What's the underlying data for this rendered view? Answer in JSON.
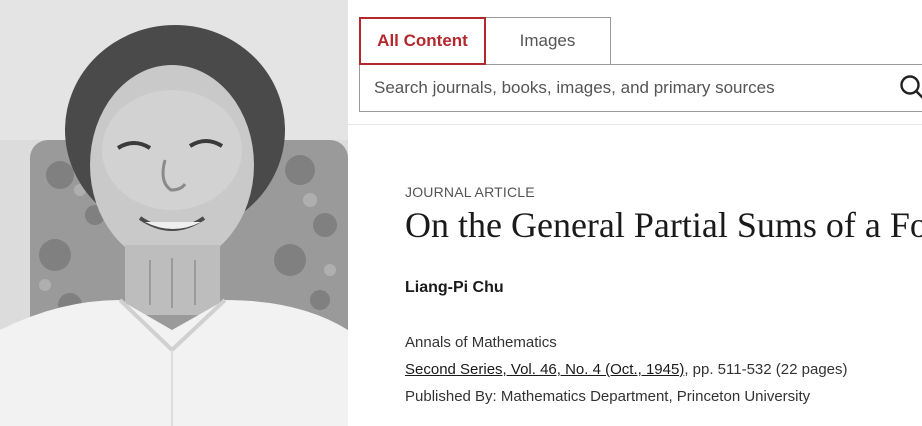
{
  "tabs": {
    "all_content": "All Content",
    "images": "Images",
    "active_color": "#b3282d"
  },
  "search": {
    "placeholder": "Search journals, books, images, and primary sources",
    "icon": "search-icon"
  },
  "article": {
    "type": "JOURNAL ARTICLE",
    "title": "On the General Partial Sums of a Fo",
    "author": "Liang-Pi Chu",
    "journal": "Annals of Mathematics",
    "issue": "Second Series, Vol. 46, No. 4 (Oct., 1945)",
    "pages": ", pp. 511-532 (22 pages)",
    "publisher": "Published By: Mathematics Department, Princeton University"
  }
}
